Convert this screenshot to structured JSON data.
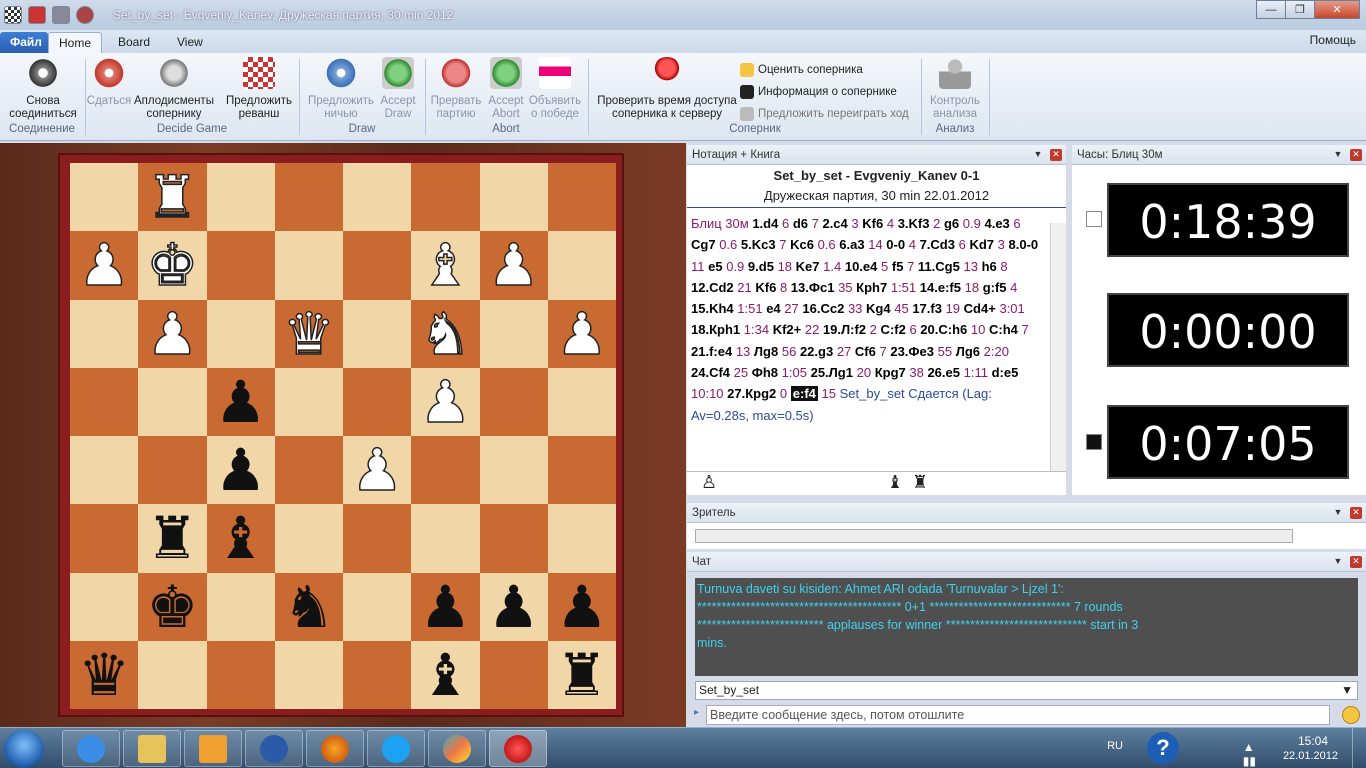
{
  "window": {
    "title": "Set_by_set - Evgveniy_Kanev, Дружеская партия, 30 min 2012"
  },
  "menu": {
    "file": "Файл",
    "tabs": [
      "Home",
      "Board",
      "View"
    ],
    "help": "Помощь"
  },
  "ribbon": {
    "reconnect": "Снова соединиться",
    "g_connect": "Соединение",
    "resign": "Сдаться",
    "applause": "Аплодисменты сопернику",
    "rematch": "Предложить реванш",
    "g_decide": "Decide Game",
    "offer_draw": "Предложить ничью",
    "accept_draw": "Accept Draw",
    "g_draw": "Draw",
    "abort": "Прервать партию",
    "accept_abort": "Accept Abort",
    "claim_win": "Объявить о победе",
    "g_abort": "Abort",
    "check_access": "Проверить время доступа соперника к серверу",
    "rate_opp": "Оценить соперника",
    "opp_info": "Информация о сопернике",
    "takeback": "Предложить переиграть ход",
    "g_opp": "Соперник",
    "analysis": "Контроль анализа",
    "g_analysis": "Анализ"
  },
  "notation": {
    "panel_title": "Нотация + Книга",
    "game": "Set_by_set - Evgveniy_Kanev  0-1",
    "event": "Дружеская партия, 30 min 22.01.2012",
    "moves_html": "<span class='t'>Блиц 30м</span> <b>1.d4</b> <span class='t'>6</span> <b>d6</b> <span class='t'>7</span> <b>2.c4</b> <span class='t'>3</span> <b>Kf6</b> <span class='t'>4</span> <b>3.Kf3</b> <span class='t'>2</span> <b>g6</b> <span class='t'>0.9</span> <b>4.e3</b> <span class='t'>6</span> <b>Cg7</b> <span class='t'>0.6</span> <b>5.Kc3</b> <span class='t'>7</span> <b>Kc6</b> <span class='t'>0.6</span> <b>6.a3</b> <span class='t'>14</span> <b>0-0</b> <span class='t'>4</span> <b>7.Cd3</b> <span class='t'>6</span> <b>Kd7</b> <span class='t'>3</span> <b>8.0-0</b> <span class='t'>11</span> <b>e5</b> <span class='t'>0.9</span> <b>9.d5</b> <span class='t'>18</span> <b>Ke7</b> <span class='t'>1.4</span> <b>10.e4</b> <span class='t'>5</span> <b>f5</b> <span class='t'>7</span> <b>11.Cg5</b> <span class='t'>13</span> <b>h6</b> <span class='t'>8</span> <b>12.Cd2</b> <span class='t'>21</span> <b>Kf6</b> <span class='t'>8</span> <b>13.Фc1</b> <span class='t'>35</span> <b>Крh7</b> <span class='t'>1:51</span> <b>14.e:f5</b> <span class='t'>18</span> <b>g:f5</b> <span class='t'>4</span> <b>15.Kh4</b> <span class='t'>1:51</span> <b>e4</b> <span class='t'>27</span> <b>16.Cc2</b> <span class='t'>33</span> <b>Kg4</b> <span class='t'>45</span> <b>17.f3</b> <span class='t'>19</span> <b>Cd4+</b> <span class='t'>3:01</span> <b>18.Крh1</b> <span class='t'>1:34</span> <b>Kf2+</b> <span class='t'>22</span> <b>19.Л:f2</b> <span class='t'>2</span> <b>C:f2</b> <span class='t'>6</span> <b>20.C:h6</b> <span class='t'>10</span> <b>C:h4</b> <span class='t'>7</span> <b>21.f:e4</b> <span class='t'>13</span> <b>Лg8</b> <span class='t'>56</span> <b>22.g3</b> <span class='t'>27</span> <b>Cf6</b> <span class='t'>7</span> <b>23.Фe3</b> <span class='t'>55</span> <b>Лg6</b> <span class='t'>2:20</span> <b>24.Cf4</b> <span class='t'>25</span> <b>Фh8</b> <span class='t'>1:05</span> <b>25.Лg1</b> <span class='t'>20</span> <b>Крg7</b> <span class='t'>38</span> <b>26.e5</b> <span class='t'>1:11</span> <b>d:e5</b> <span class='t'>10:10</span> <b>27.Крg2</b> <span class='t'>0</span> <span class='hl'><b>e:f4</b></span> <span class='t'>15</span> <span class='res'>Set_by_set Сдается (Lag: Av=0.28s, max=0.5s)</span>"
  },
  "clock": {
    "panel_title": "Часы: Блиц 30м",
    "top": "0:18:39",
    "middle": "0:00:00",
    "bottom": "0:07:05"
  },
  "viewer": {
    "panel_title": "Зритель"
  },
  "chat": {
    "panel_title": "Чат",
    "line1": "Turnuva daveti su kisiden: Ahmet ARI odada 'Turnuvalar > Ljzel 1':",
    "line2": "****************************************** 0+1 ***************************** 7 rounds",
    "line3": "************************** applauses for winner ***************************** start in 3",
    "line4": "mins.",
    "recipient": "Set_by_set",
    "placeholder": "Введите сообщение здесь, потом отошлите"
  },
  "tray": {
    "lang": "RU",
    "time": "15:04",
    "date": "22.01.2012"
  },
  "board": [
    [
      "",
      "wR",
      "",
      "",
      "",
      "",
      "",
      ""
    ],
    [
      "wP",
      "wK",
      "",
      "",
      "",
      "wB",
      "wP",
      ""
    ],
    [
      "",
      "wP",
      "",
      "wQ",
      "",
      "wN",
      "",
      "wP"
    ],
    [
      "",
      "",
      "bP",
      "",
      "",
      "wP",
      "",
      ""
    ],
    [
      "",
      "",
      "bP",
      "",
      "wP",
      "",
      "",
      ""
    ],
    [
      "",
      "bR",
      "bB",
      "",
      "",
      "",
      "",
      ""
    ],
    [
      "",
      "bK",
      "",
      "bN",
      "",
      "bP",
      "bP",
      "bP"
    ],
    [
      "bQ",
      "",
      "",
      "",
      "",
      "bB",
      "",
      "bR"
    ]
  ]
}
